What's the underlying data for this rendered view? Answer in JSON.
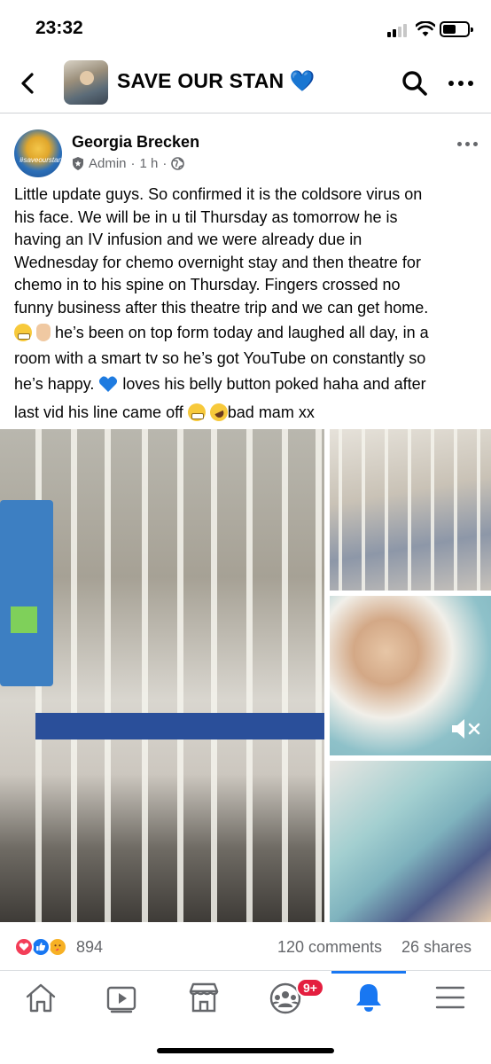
{
  "status_bar": {
    "time": "23:32"
  },
  "group": {
    "title": "SAVE OUR STAN 💙"
  },
  "post": {
    "author": "Georgia Brecken",
    "role": "Admin",
    "time": "1 h",
    "avatar_tag": "#saveourstan",
    "text_lines": [
      "Little update guys. So confirmed it is the coldsore virus on",
      "his face. We will be in u til Thursday as tomorrow he is",
      "having an IV infusion and we were already due in",
      "Wednesday for chemo overnight stay and then theatre for",
      "chemo in to his spine on Thursday. Fingers crossed no",
      "funny business after this theatre trip and we can get home."
    ],
    "line7": " he’s been on top form today and laughed all day, in a",
    "line8": "room with a smart tv so he’s got YouTube on constantly so",
    "line9a": "he’s happy. ",
    "line9b": " loves his belly button poked haha and after",
    "line10a": "last vid his line came off ",
    "line10b": "bad mam xx"
  },
  "engagement": {
    "reaction_count": "894",
    "comments": "120 comments",
    "shares": "26 shares"
  },
  "nav": {
    "notification_badge": "9+"
  },
  "colors": {
    "accent": "#1877f2",
    "badge": "#e41e3f",
    "secondary_text": "#65676b"
  },
  "icons": [
    "back-icon",
    "search-icon",
    "more-icon",
    "admin-shield-icon",
    "globe-icon",
    "home-icon",
    "watch-icon",
    "marketplace-icon",
    "groups-icon",
    "bell-icon",
    "menu-icon",
    "mute-icon"
  ]
}
